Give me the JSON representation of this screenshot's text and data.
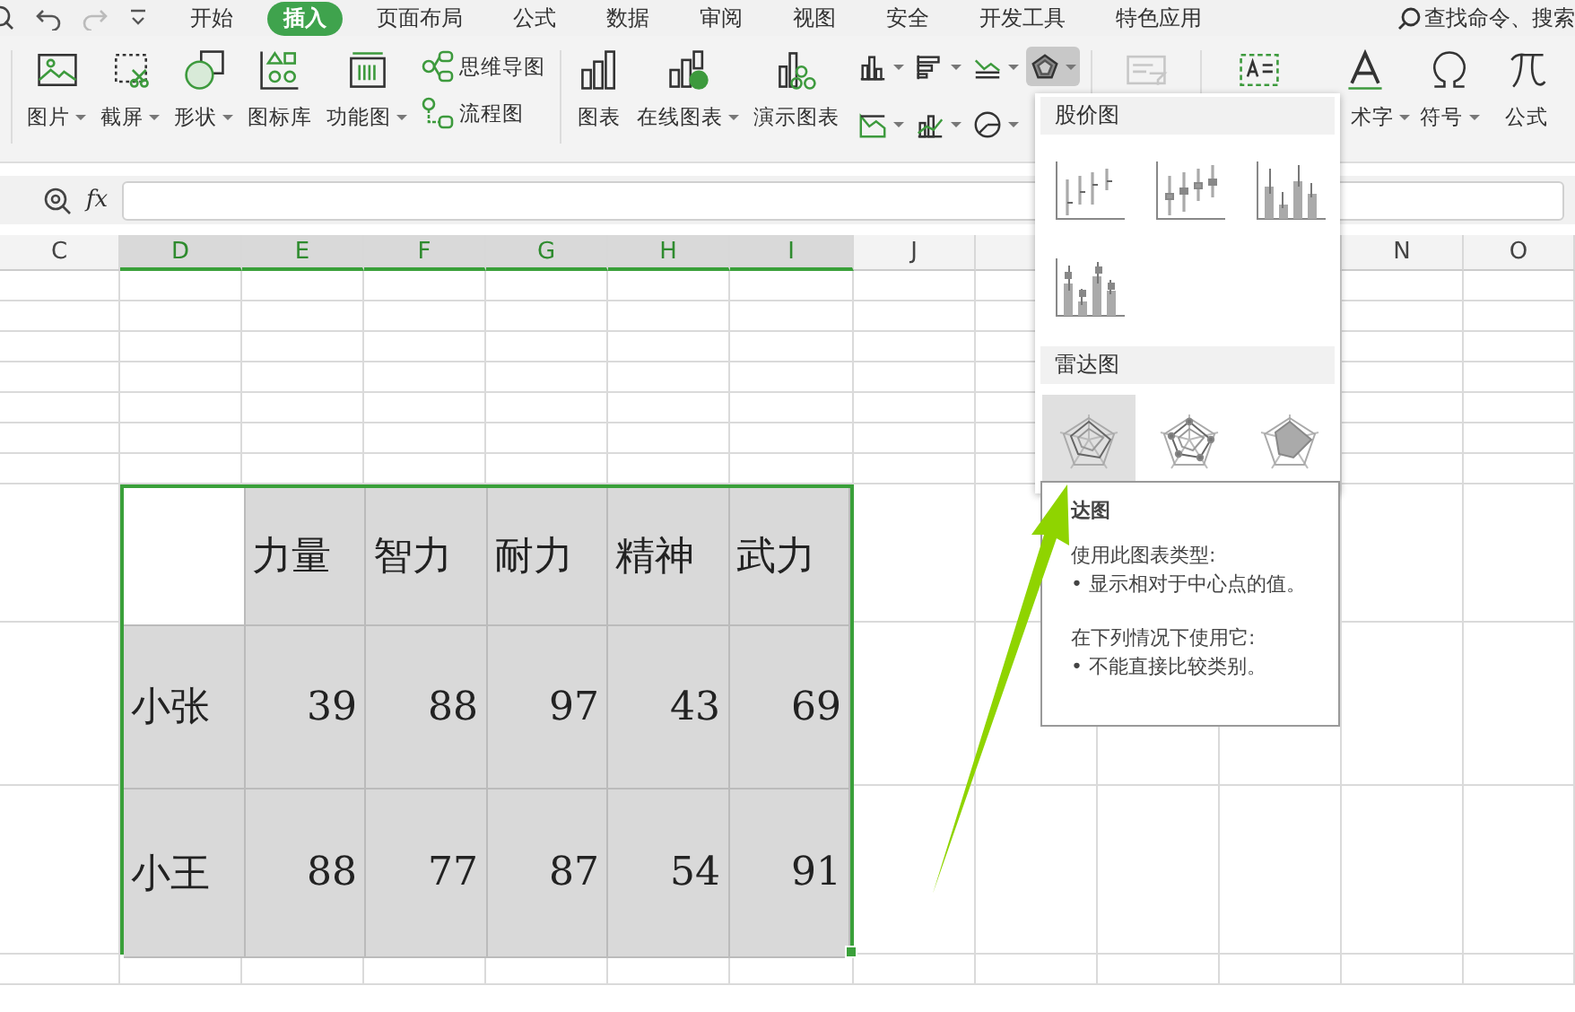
{
  "tabs": [
    {
      "label": "开始",
      "selected": false
    },
    {
      "label": "插入",
      "selected": true
    },
    {
      "label": "页面布局",
      "selected": false
    },
    {
      "label": "公式",
      "selected": false
    },
    {
      "label": "数据",
      "selected": false
    },
    {
      "label": "审阅",
      "selected": false
    },
    {
      "label": "视图",
      "selected": false
    },
    {
      "label": "安全",
      "selected": false
    },
    {
      "label": "开发工具",
      "selected": false
    },
    {
      "label": "特色应用",
      "selected": false
    }
  ],
  "search": {
    "placeholder": "查找命令、搜索"
  },
  "ribbon_left": [
    {
      "kind": "picture",
      "label": "图片",
      "dropdown": true
    },
    {
      "kind": "screenshot",
      "label": "截屏",
      "dropdown": true
    },
    {
      "kind": "shape",
      "label": "形状",
      "dropdown": true
    },
    {
      "kind": "iconlib",
      "label": "图标库",
      "dropdown": false
    },
    {
      "kind": "function",
      "label": "功能图",
      "dropdown": true
    }
  ],
  "ribbon_pair": [
    {
      "kind": "mindmap",
      "label": "思维导图"
    },
    {
      "kind": "flow",
      "label": "流程图"
    }
  ],
  "ribbon_charts": [
    {
      "kind": "chart",
      "label": "图表",
      "dropdown": false
    },
    {
      "kind": "online",
      "label": "在线图表",
      "dropdown": true
    },
    {
      "kind": "demo",
      "label": "演示图表",
      "dropdown": false
    }
  ],
  "small_charts": [
    {
      "kind": "column",
      "pressed": false
    },
    {
      "kind": "bar",
      "pressed": false
    },
    {
      "kind": "line",
      "pressed": false
    },
    {
      "kind": "area",
      "pressed": false
    },
    {
      "kind": "combo",
      "pressed": false
    },
    {
      "kind": "pie",
      "pressed": false
    },
    {
      "kind": "radar",
      "pressed": true
    }
  ],
  "ribbon_right": [
    {
      "kind": "pivot",
      "disabled": true
    },
    {
      "kind": "textbox",
      "disabled": false
    },
    {
      "kind": "art",
      "label": "术字",
      "dropdown": true,
      "disabled": false
    },
    {
      "kind": "symbol",
      "label": "符号",
      "dropdown": true,
      "disabled": false
    },
    {
      "kind": "formula",
      "label": "公式",
      "dropdown": false,
      "disabled": false
    }
  ],
  "formula_bar": {
    "fx": "fx"
  },
  "columns": [
    {
      "label": "C",
      "selected": false
    },
    {
      "label": "D",
      "selected": true
    },
    {
      "label": "E",
      "selected": true
    },
    {
      "label": "F",
      "selected": true
    },
    {
      "label": "G",
      "selected": true
    },
    {
      "label": "H",
      "selected": true
    },
    {
      "label": "I",
      "selected": true
    },
    {
      "label": "J",
      "selected": false
    },
    {
      "label": "N",
      "selected": false
    },
    {
      "label": "O",
      "selected": false
    }
  ],
  "table": {
    "headers": [
      "力量",
      "智力",
      "耐力",
      "精神",
      "武力"
    ],
    "rows": [
      {
        "name": "小张",
        "values": [
          "39",
          "88",
          "97",
          "43",
          "69"
        ]
      },
      {
        "name": "小王",
        "values": [
          "88",
          "77",
          "87",
          "54",
          "91"
        ]
      }
    ]
  },
  "chart_menu": {
    "sections": [
      {
        "title": "股价图",
        "items": [
          {
            "kind": "stock-hlc",
            "selected": false
          },
          {
            "kind": "stock-ohlc",
            "selected": false
          },
          {
            "kind": "stock-vhlc",
            "selected": false
          },
          {
            "kind": "stock-vohlc",
            "selected": false
          }
        ]
      },
      {
        "title": "雷达图",
        "items": [
          {
            "kind": "radar",
            "selected": true
          },
          {
            "kind": "radar-markers",
            "selected": false
          },
          {
            "kind": "radar-filled",
            "selected": false
          }
        ]
      }
    ]
  },
  "tooltip": {
    "title": "达图",
    "paragraphs": [
      [
        "使用此图表类型:",
        "• 显示相对于中心点的值。"
      ],
      [
        "在下列情况下使用它:",
        "• 不能直接比较类别。"
      ]
    ]
  }
}
